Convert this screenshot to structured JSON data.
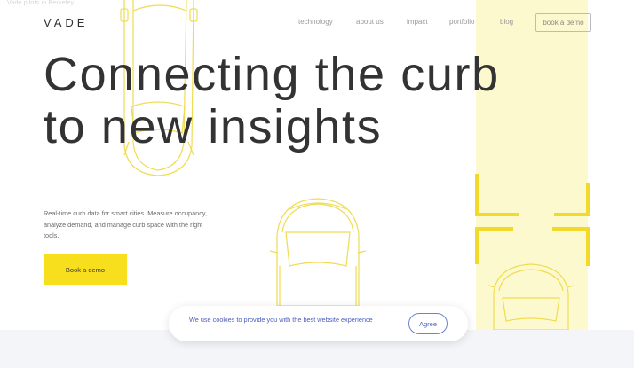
{
  "top_note": "Vade pilots in Berkeley",
  "logo": "VADE",
  "nav": {
    "items": [
      "technology",
      "about us",
      "impact",
      "portfolio",
      "blog"
    ],
    "demo_label": "book a demo"
  },
  "hero": {
    "title_line1": "Connecting the curb",
    "title_line2": "to new insights",
    "subtitle": "Real-time curb data for smart cities. Measure occupancy, analyze demand, and manage curb space with the right tools.",
    "cta_label": "Book a demo"
  },
  "cookie": {
    "text": "We use cookies to provide you with the best website experience",
    "agree_label": "Agree"
  },
  "colors": {
    "accent_yellow": "#f7df1e",
    "lane_yellow": "#fdf9cf",
    "car_outline": "#f0dc52",
    "cookie_blue": "#4a5fc1"
  }
}
